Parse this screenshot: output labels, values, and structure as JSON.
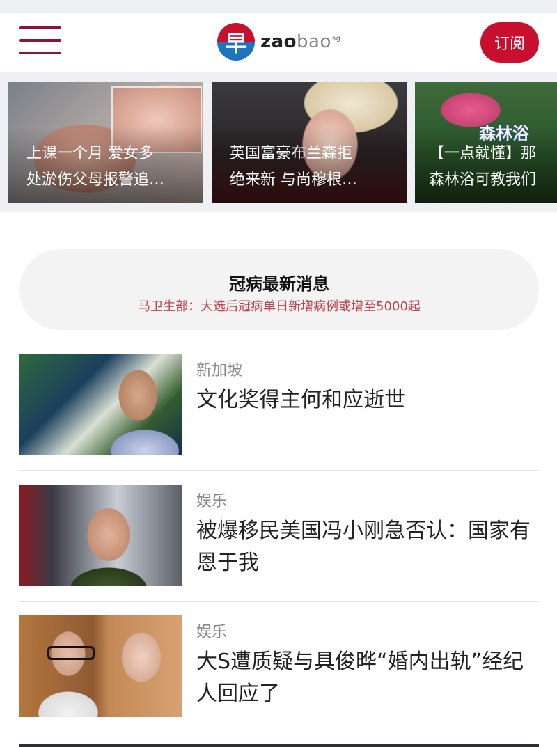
{
  "header": {
    "logo_mark": "早",
    "logo_zao": "zao",
    "logo_bao": "bao",
    "logo_sup": "sg",
    "subscribe_label": "订阅"
  },
  "carousel": [
    {
      "title": "上课一个月 爱女多\n处淤伤父母报警追…"
    },
    {
      "title": "英国富豪布兰森拒\n绝来新 与尚穆根…"
    },
    {
      "title": "【一点就懂】那\n森林浴可教我们",
      "sign_text": "森林浴"
    }
  ],
  "covid": {
    "title": "冠病最新消息",
    "subtitle": "马卫生部：大选后冠病单日新增病例或增至5000起"
  },
  "articles": [
    {
      "category": "新加坡",
      "headline": "文化奖得主何和应逝世"
    },
    {
      "category": "娱乐",
      "headline": "被爆移民美国冯小刚急否认：国家有恩于我"
    },
    {
      "category": "娱乐",
      "headline": "大S遭质疑与具俊晔“婚内出轨”经纪人回应了"
    }
  ],
  "colors": {
    "brand_red": "#c8102e",
    "brand_blue": "#1e73be",
    "menu_maroon": "#8b1538",
    "alert_red": "#c24147"
  }
}
